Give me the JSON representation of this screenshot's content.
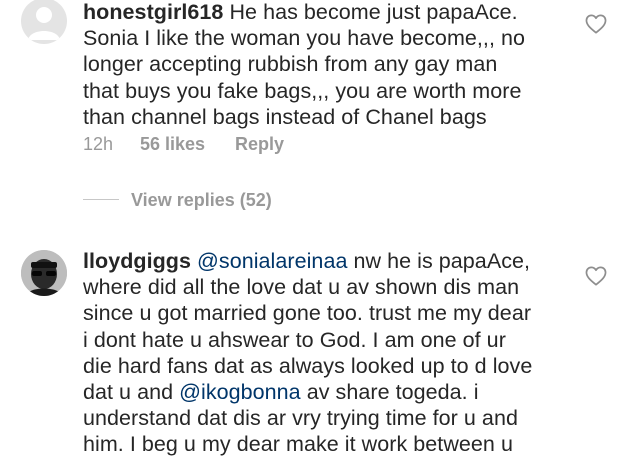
{
  "comments": [
    {
      "username": "honestgirl618",
      "lines": [
        "He has become just papaAce.",
        "Sonia I like the woman you have become,,, no",
        "longer accepting rubbish from any gay man",
        "that buys you fake bags,,, you are worth more",
        "than channel bags instead of Chanel bags"
      ],
      "time": "12h",
      "likes": "56 likes",
      "reply_label": "Reply",
      "view_replies": "View replies (52)"
    },
    {
      "username": "lloydgiggs",
      "mention": "@sonialareinaa",
      "first_line_rest": " nw he is papaAce,",
      "lines": [
        "where did all the love dat u av shown dis man",
        "since u got married gone too. trust me my dear",
        "i dont hate u ahswear to God. I am one of ur",
        "die hard fans dat as always looked up to d love"
      ],
      "line6_pre": "dat u and ",
      "mention2": "@ikogbonna",
      "line6_post": " av share togeda. i",
      "lines_tail": [
        "understand dat dis ar vry trying time for u and",
        "him. I beg u my dear make it work between u"
      ]
    }
  ],
  "icons": {
    "like": "heart-outline-icon",
    "avatar_default": "default-avatar-icon",
    "avatar_photo": "user-photo-avatar"
  },
  "colors": {
    "text": "#262626",
    "secondary": "#999999",
    "mention": "#003569"
  }
}
